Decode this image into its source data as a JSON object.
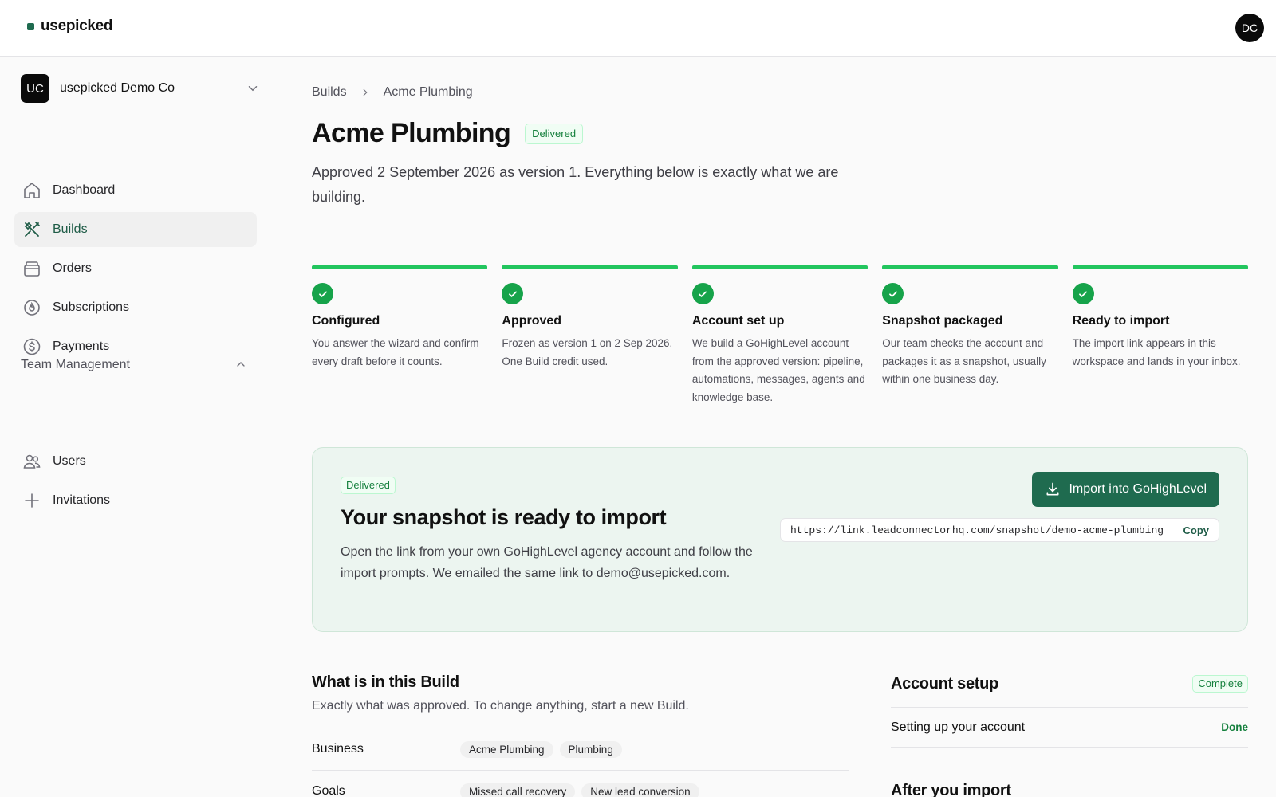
{
  "brand": {
    "name": "usepicked"
  },
  "user": {
    "initials": "DC"
  },
  "org": {
    "initials": "UC",
    "name": "usepicked Demo Co"
  },
  "nav": {
    "items": [
      {
        "label": "Dashboard",
        "icon": "home-icon"
      },
      {
        "label": "Builds",
        "icon": "tools-icon",
        "active": true
      },
      {
        "label": "Orders",
        "icon": "box-icon"
      },
      {
        "label": "Subscriptions",
        "icon": "flame-icon"
      },
      {
        "label": "Payments",
        "icon": "dollar-icon"
      }
    ],
    "team_section": "Team Management",
    "team_items": [
      {
        "label": "Users",
        "icon": "users-icon"
      },
      {
        "label": "Invitations",
        "icon": "plus-icon"
      }
    ]
  },
  "breadcrumb": {
    "root": "Builds",
    "current": "Acme Plumbing"
  },
  "page": {
    "title": "Acme Plumbing",
    "status": "Delivered",
    "subtitle": "Approved 2 September 2026 as version 1. Everything below is exactly what we are building."
  },
  "steps": [
    {
      "title": "Configured",
      "desc": "You answer the wizard and confirm every draft before it counts.",
      "complete": true
    },
    {
      "title": "Approved",
      "desc": "Frozen as version 1 on 2 Sep 2026. One Build credit used.",
      "complete": true
    },
    {
      "title": "Account set up",
      "desc": "We build a GoHighLevel account from the approved version: pipeline, automations, messages, agents and knowledge base.",
      "complete": true
    },
    {
      "title": "Snapshot packaged",
      "desc": "Our team checks the account and packages it as a snapshot, usually within one business day.",
      "complete": true
    },
    {
      "title": "Ready to import",
      "desc": "The import link appears in this workspace and lands in your inbox.",
      "complete": true
    }
  ],
  "snapshot": {
    "badge": "Delivered",
    "title": "Your snapshot is ready to import",
    "text": "Open the link from your own GoHighLevel agency account and follow the import prompts. We emailed the same link to demo@usepicked.com.",
    "button": "Import into GoHighLevel",
    "url": "https://link.leadconnectorhq.com/snapshot/demo-acme-plumbing",
    "copy": "Copy"
  },
  "build_contents": {
    "title": "What is in this Build",
    "subtitle": "Exactly what was approved. To change anything, start a new Build.",
    "rows": [
      {
        "label": "Business",
        "chips": [
          "Acme Plumbing",
          "Plumbing"
        ]
      },
      {
        "label": "Goals",
        "chips": [
          "Missed call recovery",
          "New lead conversion"
        ]
      }
    ]
  },
  "account_setup": {
    "title": "Account setup",
    "badge": "Complete",
    "rows": [
      {
        "label": "Setting up your account",
        "status": "Done"
      }
    ],
    "after_title": "After you import"
  },
  "colors": {
    "accent": "#1f6b4f",
    "success": "#16a34a",
    "progress": "#22c55e",
    "panel_bg": "#ecf5f0"
  }
}
